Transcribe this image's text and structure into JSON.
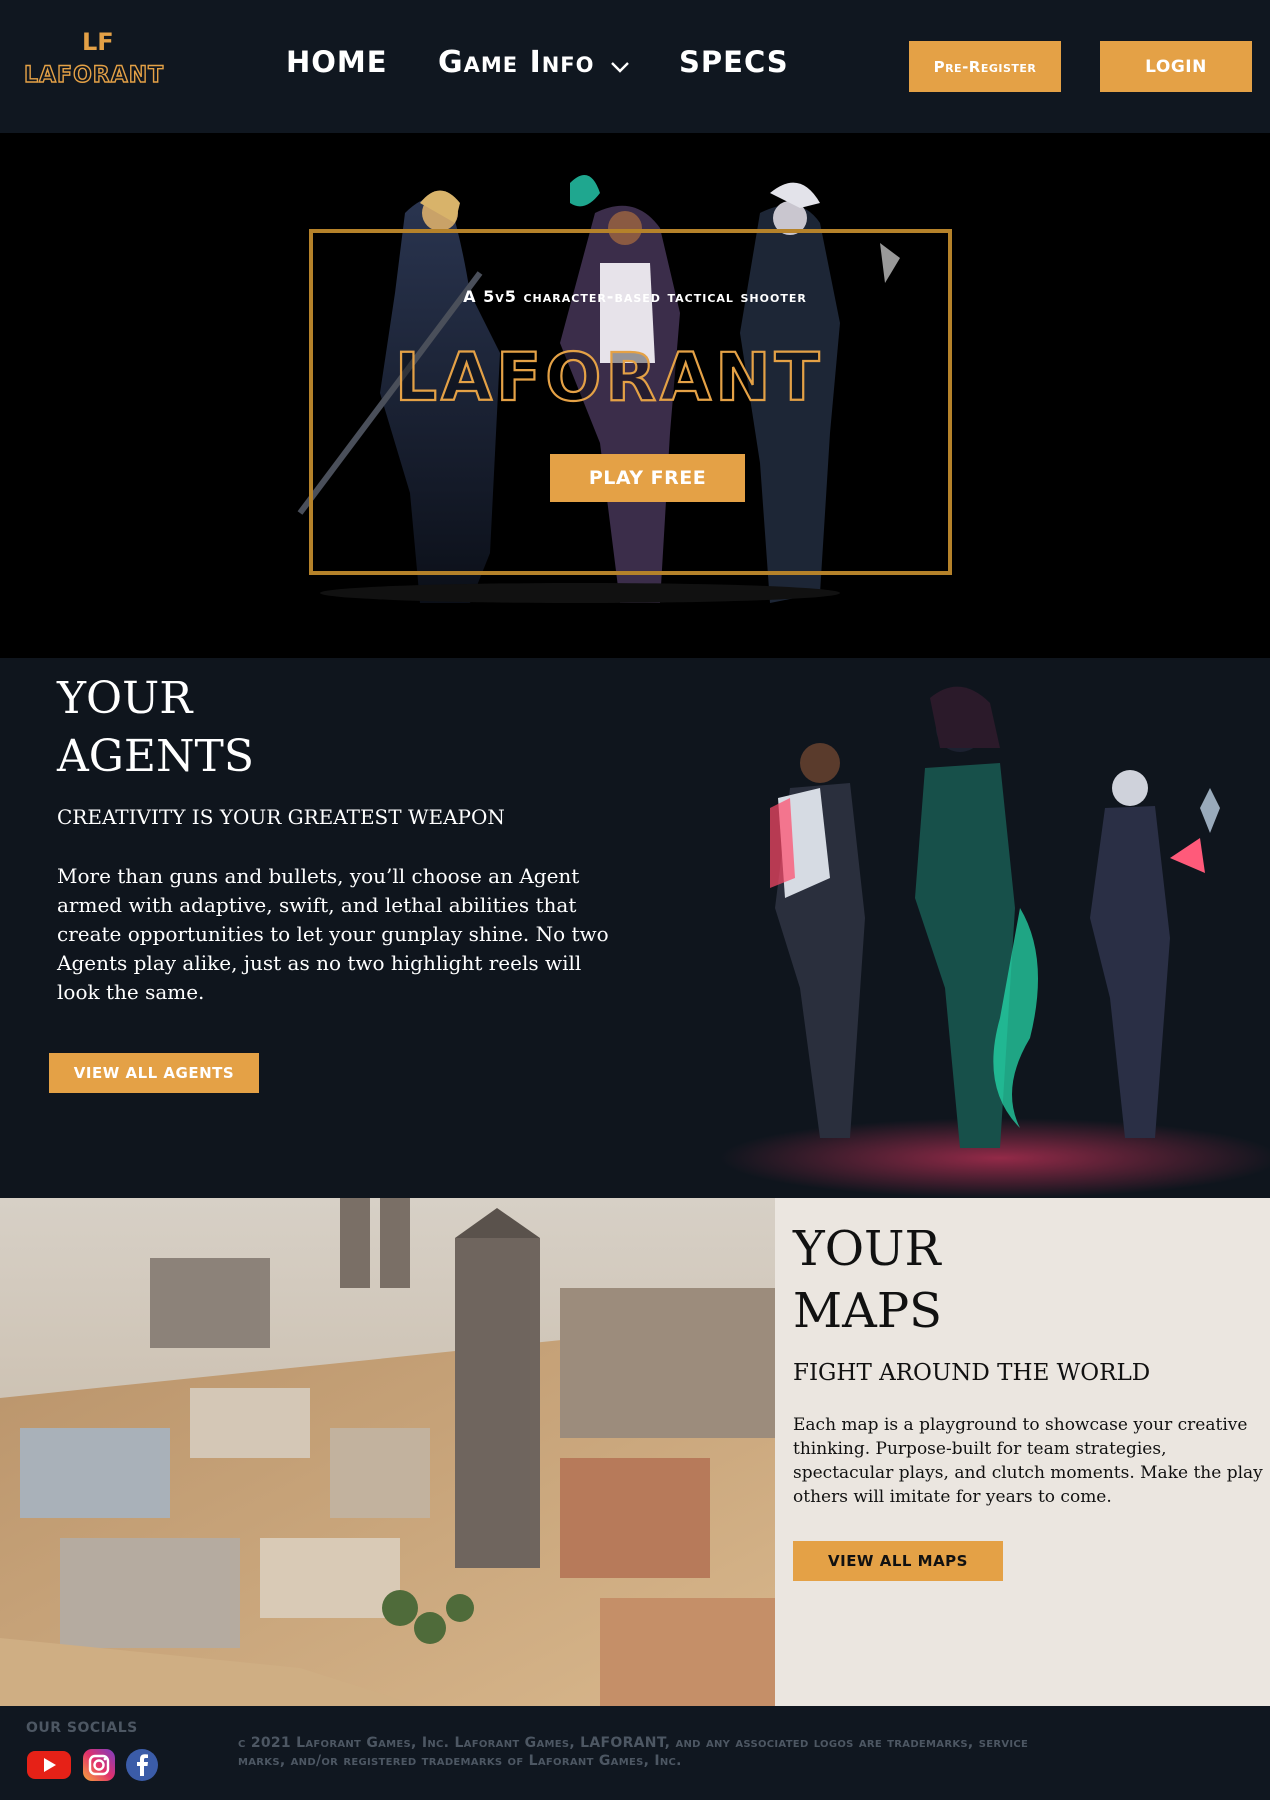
{
  "brand": {
    "logo_monogram": "LF",
    "logo_wordmark": "LAFORANT",
    "accent_color": "#e4a146"
  },
  "nav": {
    "home": "HOME",
    "game_info": "Game Info",
    "specs": "SPECS",
    "pre_register": "Pre-Register",
    "login": "LOGIN",
    "dropdown_icon": "chevron-down-icon"
  },
  "hero": {
    "tagline": "A 5v5 character-based tactical shooter",
    "title": "LAFORANT",
    "cta": "PLAY FREE"
  },
  "agents": {
    "heading_line1": "YOUR",
    "heading_line2": "AGENTS",
    "subheading": "CREATIVITY IS YOUR GREATEST WEAPON",
    "body": "More than guns and bullets, you’ll choose an Agent armed with adaptive, swift, and lethal abilities that create opportunities to let your gunplay shine. No two Agents play alike, just as no two highlight reels will look the same.",
    "cta": "VIEW ALL AGENTS"
  },
  "maps": {
    "heading_line1": "YOUR",
    "heading_line2": "MAPS",
    "subheading": "FIGHT AROUND THE WORLD",
    "body": "Each map is a playground to showcase your creative thinking. Purpose-built for team strategies, spectacular plays, and clutch moments. Make the play others will imitate for years to come.",
    "cta": "VIEW ALL MAPS"
  },
  "footer": {
    "socials_label": "OUR SOCIALS",
    "social_icons": [
      "youtube-icon",
      "instagram-icon",
      "facebook-icon"
    ],
    "copyright": "c 2021 Laforant Games, Inc. Laforant Games, LAFORANT, and any associated logos are trademarks, service marks, and/or registered trademarks of Laforant Games, Inc."
  }
}
